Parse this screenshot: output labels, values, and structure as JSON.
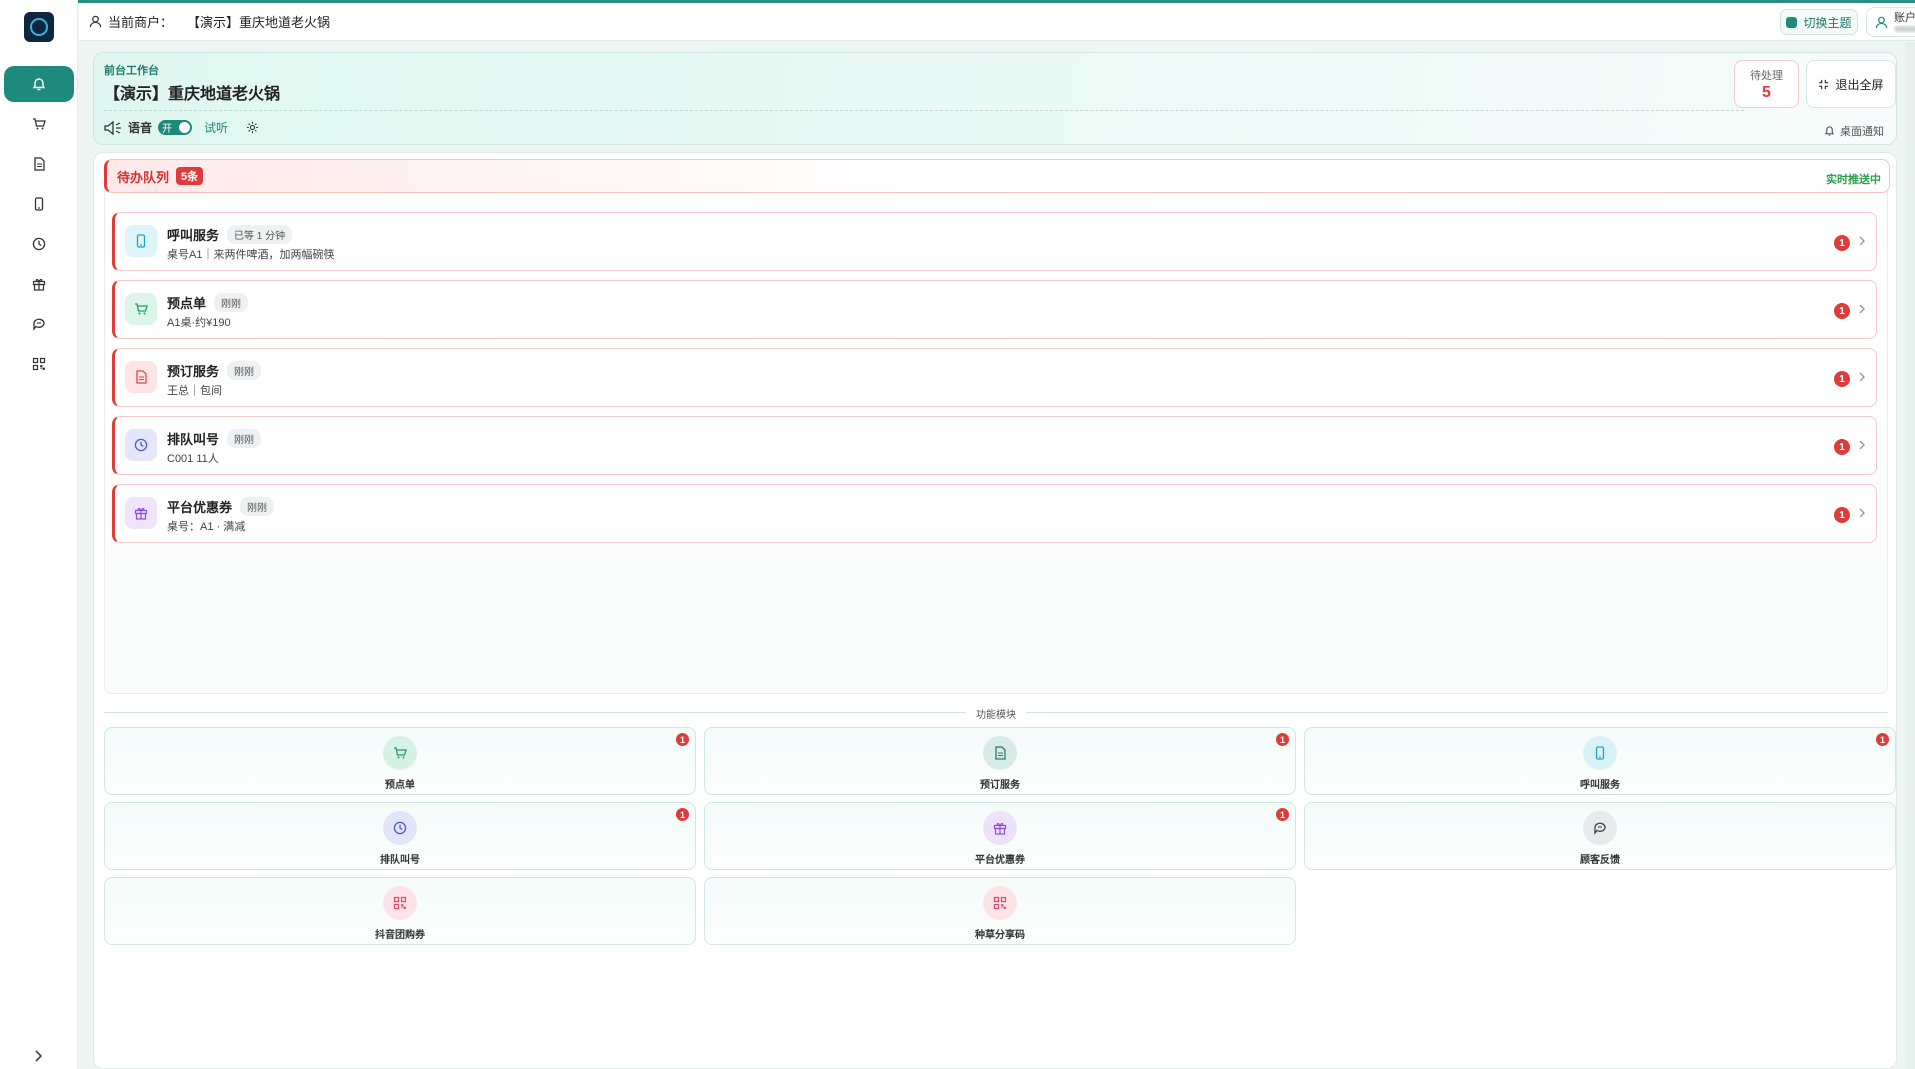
{
  "header": {
    "merchant_label": "当前商户：",
    "merchant_value": "【演示】重庆地道老火锅",
    "theme_button": "切换主题",
    "account_label": "账户"
  },
  "sidebar": {
    "items": [
      {
        "icon": "bell-icon",
        "active": true
      },
      {
        "icon": "cart-icon",
        "active": false
      },
      {
        "icon": "document-icon",
        "active": false
      },
      {
        "icon": "phone-icon",
        "active": false
      },
      {
        "icon": "clock-icon",
        "active": false
      },
      {
        "icon": "gift-icon",
        "active": false
      },
      {
        "icon": "chat-icon",
        "active": false
      },
      {
        "icon": "qrcode-icon",
        "active": false
      }
    ],
    "collapse_icon": "chevron-right-icon"
  },
  "workbench": {
    "subtitle": "前台工作台",
    "store_name": "【演示】重庆地道老火锅",
    "voice_label": "语音",
    "voice_toggle": "开",
    "try_listen": "试听",
    "pending_label": "待处理",
    "pending_count": "5",
    "exit_fullscreen": "退出全屏",
    "desktop_notify": "桌面通知"
  },
  "queue": {
    "title": "待办队列",
    "count": "5条",
    "status": "实时推送中",
    "items": [
      {
        "name": "呼叫服务",
        "tag": "已等 1 分钟",
        "detail": "桌号A1｜来两件啤酒，加两幅碗筷",
        "badge": "1",
        "icon": "phone-icon",
        "color": "#1ba3c6",
        "bg": "#ddf4fa"
      },
      {
        "name": "预点单",
        "tag": "刚刚",
        "detail": "A1桌·约¥190",
        "badge": "1",
        "icon": "cart-icon",
        "color": "#1f9c6a",
        "bg": "#dcf5ea"
      },
      {
        "name": "预订服务",
        "tag": "刚刚",
        "detail": "王总｜包间",
        "badge": "1",
        "icon": "document-icon",
        "color": "#e04848",
        "bg": "#fde5e5"
      },
      {
        "name": "排队叫号",
        "tag": "刚刚",
        "detail": "C001 11人",
        "badge": "1",
        "icon": "clock-icon",
        "color": "#4a5ac9",
        "bg": "#e4e7fa"
      },
      {
        "name": "平台优惠券",
        "tag": "刚刚",
        "detail": "桌号：A1 · 满减",
        "badge": "1",
        "icon": "gift-icon",
        "color": "#8a4fd0",
        "bg": "#efe4fb"
      }
    ]
  },
  "modules": {
    "title": "功能模块",
    "items": [
      {
        "label": "预点单",
        "badge": "1",
        "icon": "cart-icon",
        "color": "#1f9c6a",
        "bg": "#d6f2e6"
      },
      {
        "label": "预订服务",
        "badge": "1",
        "icon": "document-icon",
        "color": "#2b7a6e",
        "bg": "#d9ebe7"
      },
      {
        "label": "呼叫服务",
        "badge": "1",
        "icon": "phone-icon",
        "color": "#1ba3c6",
        "bg": "#d8f2f9"
      },
      {
        "label": "排队叫号",
        "badge": "1",
        "icon": "clock-icon",
        "color": "#4a5ac9",
        "bg": "#e2e5f8"
      },
      {
        "label": "平台优惠券",
        "badge": "1",
        "icon": "gift-icon",
        "color": "#8a4fd0",
        "bg": "#ede2fa"
      },
      {
        "label": "顾客反馈",
        "badge": "",
        "icon": "chat-icon",
        "color": "#444",
        "bg": "#e6eaea"
      },
      {
        "label": "抖音团购券",
        "badge": "",
        "icon": "qrcode-icon",
        "color": "#e04868",
        "bg": "#fde2e8"
      },
      {
        "label": "种草分享码",
        "badge": "",
        "icon": "qrcode-icon",
        "color": "#e04868",
        "bg": "#fde2e8"
      }
    ]
  },
  "colors": {
    "accent": "#1e8a7b",
    "danger": "#e03b3b",
    "live": "#2aa04a"
  }
}
